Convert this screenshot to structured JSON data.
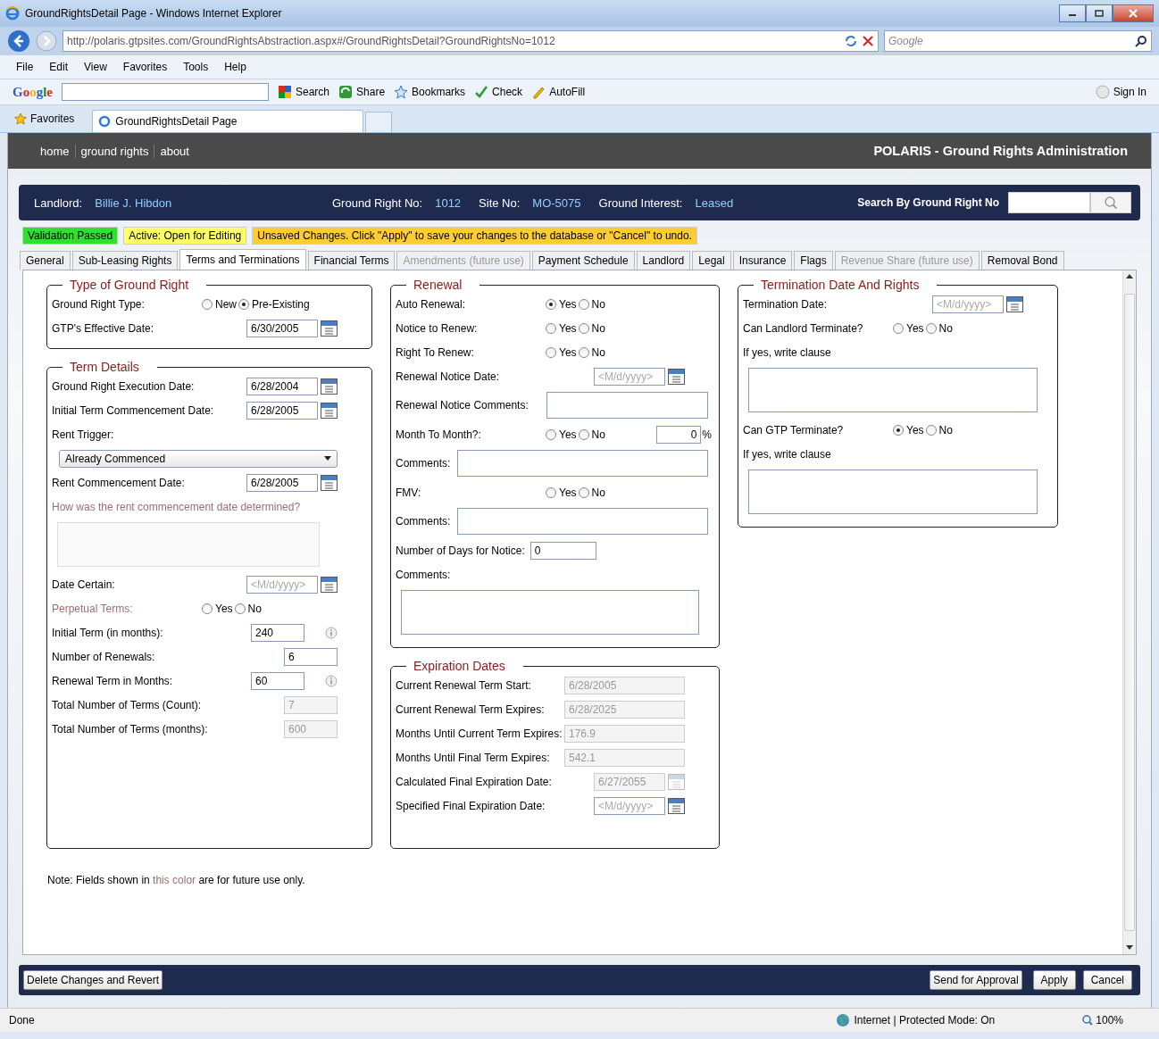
{
  "window": {
    "title": "GroundRightsDetail Page - Windows Internet Explorer"
  },
  "address_bar": {
    "url": "http://polaris.gtpsites.com/GroundRightsAbstraction.aspx#/GroundRightsDetail?GroundRightsNo=1012",
    "search_placeholder": "Google"
  },
  "menu": [
    "File",
    "Edit",
    "View",
    "Favorites",
    "Tools",
    "Help"
  ],
  "google_toolbar": {
    "logo": "Google",
    "items": [
      {
        "label": "Search",
        "kind": "search"
      },
      {
        "label": "Share",
        "kind": "share"
      },
      {
        "label": "Bookmarks",
        "kind": "star"
      },
      {
        "label": "Check",
        "kind": "check"
      },
      {
        "label": "AutoFill",
        "kind": "autofill"
      },
      {
        "label": "Sign In",
        "kind": "user"
      }
    ]
  },
  "favorites_bar": {
    "label": "Favorites",
    "tab": "GroundRightsDetail Page"
  },
  "nav": [
    "home",
    "ground rights",
    "about"
  ],
  "app_title": "POLARIS - Ground Rights Administration",
  "info_bar": {
    "items": [
      {
        "label": "Landlord:",
        "value": "Billie J. Hibdon"
      },
      {
        "label": "Ground Right No:",
        "value": "1012"
      },
      {
        "label": "Site No:",
        "value": "MO-5075"
      },
      {
        "label": "Ground Interest:",
        "value": "Leased"
      }
    ],
    "search_label": "Search By Ground Right No"
  },
  "status_badges": [
    {
      "text": "Validation Passed",
      "color": "#33dd33"
    },
    {
      "text": "Active: Open for Editing",
      "color": "#ffff66"
    },
    {
      "text": "Unsaved Changes. Click \"Apply\" to save your changes to the database or \"Cancel\" to undo.",
      "color": "#ffcc33"
    }
  ],
  "tabs": [
    {
      "label": "General",
      "selected": false,
      "disabled": false
    },
    {
      "label": "Sub-Leasing Rights",
      "selected": false,
      "disabled": false
    },
    {
      "label": "Terms and Terminations",
      "selected": true,
      "disabled": false
    },
    {
      "label": "Financial Terms",
      "selected": false,
      "disabled": false
    },
    {
      "label": "Amendments (future use)",
      "selected": false,
      "disabled": true
    },
    {
      "label": "Payment Schedule",
      "selected": false,
      "disabled": false
    },
    {
      "label": "Landlord",
      "selected": false,
      "disabled": false
    },
    {
      "label": "Legal",
      "selected": false,
      "disabled": false
    },
    {
      "label": "Insurance",
      "selected": false,
      "disabled": false
    },
    {
      "label": "Flags",
      "selected": false,
      "disabled": false
    },
    {
      "label": "Revenue Share (future use)",
      "selected": false,
      "disabled": true
    },
    {
      "label": "Removal Bond",
      "selected": false,
      "disabled": false
    }
  ],
  "columns": [
    {
      "sections": [
        {
          "title": "Type of Ground Right",
          "fields": [
            {
              "kind": "radio",
              "label": "Ground Right Type:",
              "options": [
                {
                  "label": "New",
                  "selected": false
                },
                {
                  "label": "Pre-Existing",
                  "selected": true
                }
              ]
            },
            {
              "kind": "date",
              "label": "GTP's Effective Date:",
              "value": "6/30/2005"
            }
          ]
        },
        {
          "title": "Term Details",
          "fields": [
            {
              "kind": "date",
              "label": "Ground Right Execution Date:",
              "value": "6/28/2004"
            },
            {
              "kind": "date",
              "label": "Initial Term Commencement Date:",
              "value": "6/28/2005"
            },
            {
              "kind": "label",
              "label": "Rent Trigger:"
            },
            {
              "kind": "select",
              "value": "Already Commenced"
            },
            {
              "kind": "date",
              "label": "Rent Commencement Date:",
              "value": "6/28/2005"
            },
            {
              "kind": "label",
              "label": "How was the rent commencement date determined?",
              "future": true
            },
            {
              "kind": "textarea",
              "disabled": true
            },
            {
              "kind": "date",
              "label": "Date Certain:",
              "placeholder": "<M/d/yyyy>"
            },
            {
              "kind": "radio",
              "label": "Perpetual Terms:",
              "future": true,
              "options": [
                {
                  "label": "Yes",
                  "selected": false
                },
                {
                  "label": "No",
                  "selected": false
                }
              ]
            },
            {
              "kind": "text",
              "label": "Initial Term (in months):",
              "value": "240",
              "info": true
            },
            {
              "kind": "text",
              "label": "Number of Renewals:",
              "value": "6"
            },
            {
              "kind": "text",
              "label": "Renewal Term in Months:",
              "value": "60",
              "info": true
            },
            {
              "kind": "text",
              "label": "Total Number of Terms (Count):",
              "value": "7",
              "disabled": true
            },
            {
              "kind": "text",
              "label": "Total Number of Terms (months):",
              "value": "600",
              "disabled": true
            }
          ]
        }
      ]
    },
    {
      "sections": [
        {
          "title": "Renewal",
          "fields": [
            {
              "kind": "radio",
              "label": "Auto Renewal:",
              "options": [
                {
                  "label": "Yes",
                  "selected": true
                },
                {
                  "label": "No",
                  "selected": false
                }
              ]
            },
            {
              "kind": "radio",
              "label": "Notice to Renew:",
              "options": [
                {
                  "label": "Yes",
                  "selected": false
                },
                {
                  "label": "No",
                  "selected": false
                }
              ]
            },
            {
              "kind": "radio",
              "label": "Right To Renew:",
              "options": [
                {
                  "label": "Yes",
                  "selected": false
                },
                {
                  "label": "No",
                  "selected": false
                }
              ]
            },
            {
              "kind": "date",
              "label": "Renewal Notice Date:",
              "placeholder": "<M/d/yyyy>"
            },
            {
              "kind": "comment",
              "label": "Renewal Notice Comments:"
            },
            {
              "kind": "radio",
              "label": "Month To Month?:",
              "options": [
                {
                  "label": "Yes",
                  "selected": false
                },
                {
                  "label": "No",
                  "selected": false
                }
              ],
              "percent": {
                "value": "0",
                "unit": "%"
              }
            },
            {
              "kind": "comment",
              "label": "Comments:"
            },
            {
              "kind": "radio",
              "label": "FMV:",
              "options": [
                {
                  "label": "Yes",
                  "selected": false
                },
                {
                  "label": "No",
                  "selected": false
                }
              ]
            },
            {
              "kind": "comment",
              "label": "Comments:"
            },
            {
              "kind": "number",
              "label": "Number of Days for Notice:",
              "value": "0"
            },
            {
              "kind": "label",
              "label": "Comments:"
            },
            {
              "kind": "textarea",
              "disabled": false
            }
          ]
        },
        {
          "title": "Expiration Dates",
          "fields": [
            {
              "kind": "text",
              "label": "Current Renewal Term Start:",
              "value": "6/28/2005",
              "disabled": true
            },
            {
              "kind": "text",
              "label": "Current Renewal Term Expires:",
              "value": "6/28/2025",
              "disabled": true
            },
            {
              "kind": "text",
              "label": "Months Until Current Term Expires:",
              "value": "176.9",
              "disabled": true
            },
            {
              "kind": "text",
              "label": "Months Until Final Term Expires:",
              "value": "542.1",
              "disabled": true
            },
            {
              "kind": "date",
              "label": "Calculated Final Expiration Date:",
              "value": "6/27/2055",
              "disabled": true
            },
            {
              "kind": "date",
              "label": "Specified Final Expiration Date:",
              "placeholder": "<M/d/yyyy>"
            }
          ]
        }
      ]
    },
    {
      "sections": [
        {
          "title": "Termination Date And Rights",
          "fields": [
            {
              "kind": "date",
              "label": "Termination Date:",
              "placeholder": "<M/d/yyyy>"
            },
            {
              "kind": "radio",
              "label": "Can Landlord Terminate?",
              "options": [
                {
                  "label": "Yes",
                  "selected": false
                },
                {
                  "label": "No",
                  "selected": false
                }
              ]
            },
            {
              "kind": "label",
              "label": "If yes, write clause"
            },
            {
              "kind": "textarea",
              "disabled": false
            },
            {
              "kind": "radio",
              "label": "Can GTP Terminate?",
              "options": [
                {
                  "label": "Yes",
                  "selected": true
                },
                {
                  "label": "No",
                  "selected": false
                }
              ]
            },
            {
              "kind": "label",
              "label": "If yes, write clause"
            },
            {
              "kind": "textarea",
              "disabled": false
            }
          ]
        }
      ]
    }
  ],
  "note": {
    "before": "Note: Fields shown in ",
    "highlight": "this color",
    "after": " are for future use only."
  },
  "actions": {
    "left": [
      "Delete Changes and Revert"
    ],
    "right": [
      "Send for Approval",
      "Apply",
      "Cancel"
    ]
  },
  "status_bar": {
    "text": "Done",
    "zone": "Internet | Protected Mode: On",
    "zoom": "100%"
  }
}
